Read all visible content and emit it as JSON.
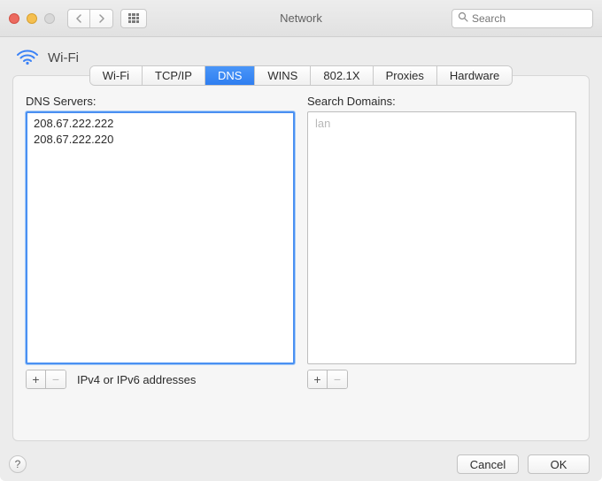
{
  "window": {
    "title": "Network",
    "search_placeholder": "Search"
  },
  "section": {
    "connection_name": "Wi-Fi"
  },
  "tabs": [
    {
      "key": "wifi",
      "label": "Wi-Fi",
      "active": false
    },
    {
      "key": "tcpip",
      "label": "TCP/IP",
      "active": false
    },
    {
      "key": "dns",
      "label": "DNS",
      "active": true
    },
    {
      "key": "wins",
      "label": "WINS",
      "active": false
    },
    {
      "key": "8021x",
      "label": "802.1X",
      "active": false
    },
    {
      "key": "proxies",
      "label": "Proxies",
      "active": false
    },
    {
      "key": "hardware",
      "label": "Hardware",
      "active": false
    }
  ],
  "dns": {
    "label": "DNS Servers:",
    "servers": [
      "208.67.222.222",
      "208.67.222.220"
    ],
    "hint": "IPv4 or IPv6 addresses"
  },
  "search_domains": {
    "label": "Search Domains:",
    "placeholder": "lan",
    "items": []
  },
  "buttons": {
    "cancel": "Cancel",
    "ok": "OK",
    "plus": "+",
    "minus": "−"
  }
}
